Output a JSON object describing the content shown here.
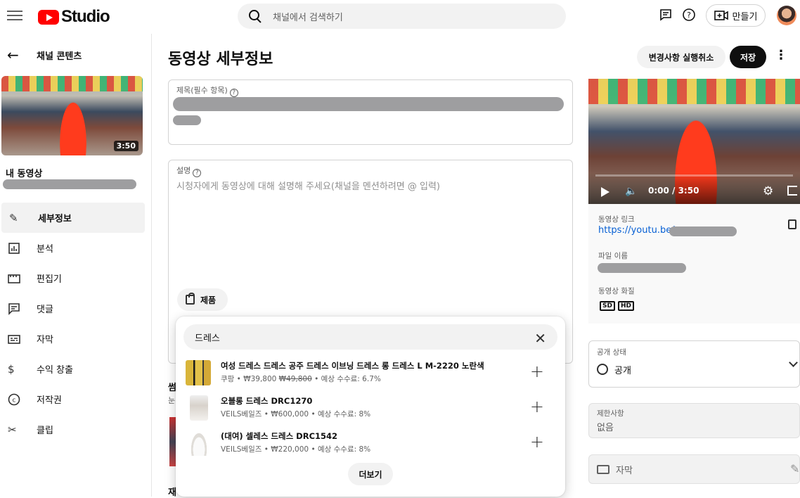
{
  "app": {
    "logo_text": "Studio",
    "search_placeholder": "채널에서 검색하기",
    "create_label": "만들기"
  },
  "sidebar": {
    "back_label": "채널 콘텐츠",
    "thumb_duration": "3:50",
    "my_video_label": "내 동영상",
    "items": [
      {
        "label": "세부정보",
        "icon": "pencil-icon",
        "active": true
      },
      {
        "label": "분석",
        "icon": "analytics-icon"
      },
      {
        "label": "편집기",
        "icon": "editor-icon"
      },
      {
        "label": "댓글",
        "icon": "comments-icon"
      },
      {
        "label": "자막",
        "icon": "subtitles-icon"
      },
      {
        "label": "수익 창출",
        "icon": "dollar-icon"
      },
      {
        "label": "저작권",
        "icon": "copyright-icon"
      },
      {
        "label": "클립",
        "icon": "scissors-icon"
      }
    ]
  },
  "main": {
    "title": "동영상 세부정보",
    "undo_label": "변경사항 실행취소",
    "save_label": "저장",
    "title_field_label": "제목(필수 항목)",
    "desc_field_label": "설명",
    "desc_placeholder": "시청자에게 동영상에 대해 설명해 주세요(채널을 멘션하려면 @ 입력)",
    "product_chip": "제품",
    "behind_text_1": "썸",
    "behind_text_2": "눈",
    "behind_text_3": "재"
  },
  "product_popup": {
    "query": "드레스",
    "products": [
      {
        "title": "여성 드레스 드레스 공주 드레스 이브닝 드레스 롱 드레스 L M-2220 노란색",
        "store": "쿠팡",
        "price": "₩39,800",
        "old_price": "₩49,800",
        "commission": "예상 수수료: 6.7%"
      },
      {
        "title": "오블롱 드레스 DRC1270",
        "store": "VEILS베일즈",
        "price": "₩600,000",
        "old_price": "",
        "commission": "예상 수수료: 8%"
      },
      {
        "title": "(대여) 셀레스 드레스 DRC1542",
        "store": "VEILS베일즈",
        "price": "₩220,000",
        "old_price": "",
        "commission": "예상 수수료: 8%"
      }
    ],
    "more_label": "더보기"
  },
  "preview": {
    "time": "0:00 / 3:50",
    "link_label": "동영상 링크",
    "link_text": "https://youtu.be/",
    "filename_label": "파일 이름",
    "quality_label": "동영상 화질",
    "quality_badges": [
      "SD",
      "HD"
    ]
  },
  "visibility": {
    "label": "공개 상태",
    "value": "공개"
  },
  "restrictions": {
    "label": "제한사항",
    "value": "없음"
  },
  "subtitles": {
    "label": "자막"
  }
}
